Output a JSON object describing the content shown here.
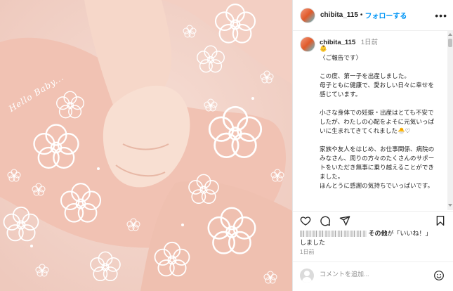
{
  "photo": {
    "caption": "Hello Baby...",
    "alt": "baby hand holding parent's finger with flower illustrations"
  },
  "header": {
    "username": "chibita_115",
    "separator": "•",
    "follow_label": "フォローする",
    "more_label": "•••"
  },
  "caption": {
    "username": "chibita_115",
    "time": "1日前",
    "text": "👶\n〈ご報告です〉\n\nこの度、第一子を出産しました。\n母子ともに健康で、愛おしい日々に幸せを感じています。\n\n小さな身体での妊娠・出産はとても不安でしたが、わたしの心配をよそに元気いっぱいに生まれてきてくれました🐣♡\n\n家族や友人をはじめ、お仕事関係、病院のみなさん、周りの方々のたくさんのサポートをいただき無事に乗り越えることができました。\nほんとうに感謝の気持ちでいっぱいです。"
  },
  "actions": {
    "like_icon": "heart-icon",
    "comment_icon": "comment-icon",
    "share_icon": "share-icon",
    "save_icon": "bookmark-icon"
  },
  "likes": {
    "others_label": "その他",
    "suffix": "が「いいね！」",
    "line2": "しました"
  },
  "post_time": "1日前",
  "comment": {
    "placeholder": "コメントを追加..."
  },
  "colors": {
    "accent": "#0095f6",
    "text": "#262626",
    "muted": "#8e8e8e",
    "photo_bg": "#f7e3dd"
  }
}
